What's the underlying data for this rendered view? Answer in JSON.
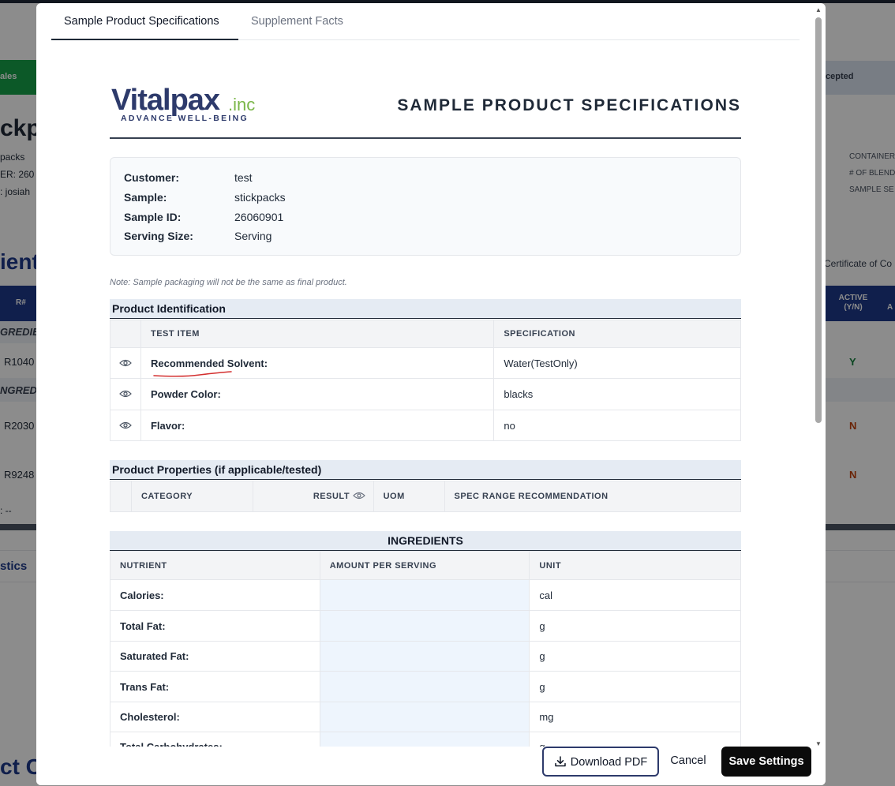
{
  "background": {
    "green_tab": "ales",
    "accepted_tab": "cepted",
    "title_fragment": "ckp",
    "meta_lines": [
      "packs",
      "ER:  260",
      ":  josiah"
    ],
    "right_meta": [
      "CONTAINER",
      "# OF BLEND",
      "SAMPLE SE"
    ],
    "section_fragment": "ient",
    "certificate": "Certificate of Co",
    "col_r": "R#",
    "col_active": "ACTIVE (Y/N)",
    "col_a": "A",
    "group1": "GREDIE",
    "group2": "NGRED",
    "rows": [
      {
        "id": "R1040",
        "active": "Y"
      },
      {
        "id": "R2030",
        "active": "N"
      },
      {
        "id": "R9248",
        "active": "N"
      }
    ],
    "summary": ":  --",
    "stats_fragment": "stics",
    "bottom_fragment": "ct C"
  },
  "tabs": [
    {
      "label": "Sample Product Specifications",
      "active": true
    },
    {
      "label": "Supplement Facts",
      "active": false
    }
  ],
  "logo": {
    "brand": "Vitalpax",
    "suffix": ".inc",
    "tagline": "ADVANCE WELL-BEING"
  },
  "doc_title": "SAMPLE PRODUCT SPECIFICATIONS",
  "info": {
    "customer_label": "Customer:",
    "customer": "test",
    "sample_label": "Sample:",
    "sample": "stickpacks",
    "sample_id_label": "Sample ID:",
    "sample_id": "26060901",
    "serving_label": "Serving Size:",
    "serving": "Serving"
  },
  "note": "Note: Sample packaging will not be the same as final product.",
  "product_identification": {
    "title": "Product Identification",
    "headers": [
      "TEST ITEM",
      "SPECIFICATION"
    ],
    "rows": [
      {
        "item": "Recommended Solvent:",
        "spec": "Water(TestOnly)"
      },
      {
        "item": "Powder Color:",
        "spec": "blacks"
      },
      {
        "item": "Flavor:",
        "spec": "no"
      }
    ]
  },
  "product_properties": {
    "title": "Product Properties (if applicable/tested)",
    "headers": [
      "CATEGORY",
      "RESULT",
      "UOM",
      "SPEC RANGE RECOMMENDATION"
    ]
  },
  "ingredients": {
    "title": "INGREDIENTS",
    "headers": [
      "NUTRIENT",
      "AMOUNT PER SERVING",
      "UNIT"
    ],
    "rows": [
      {
        "nutrient": "Calories:",
        "unit": "cal"
      },
      {
        "nutrient": "Total Fat:",
        "unit": "g"
      },
      {
        "nutrient": "Saturated Fat:",
        "unit": "g"
      },
      {
        "nutrient": "Trans Fat:",
        "unit": "g"
      },
      {
        "nutrient": "Cholesterol:",
        "unit": "mg"
      },
      {
        "nutrient": "Total Carbohydrates:",
        "unit": "g"
      }
    ]
  },
  "footer": {
    "download_label": "Download PDF",
    "cancel_label": "Cancel",
    "save_label": "Save Settings"
  },
  "colors": {
    "brand_navy": "#2d3a6b",
    "brand_green": "#7ab648",
    "active_y": "#15803d",
    "active_n": "#c2410c",
    "header_fill": "#e5ebf3"
  }
}
